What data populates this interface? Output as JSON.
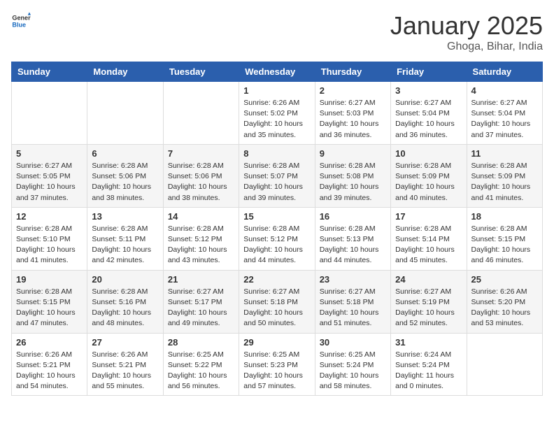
{
  "header": {
    "logo_general": "General",
    "logo_blue": "Blue",
    "title": "January 2025",
    "location": "Ghoga, Bihar, India"
  },
  "days_of_week": [
    "Sunday",
    "Monday",
    "Tuesday",
    "Wednesday",
    "Thursday",
    "Friday",
    "Saturday"
  ],
  "weeks": [
    [
      null,
      null,
      null,
      {
        "day": "1",
        "sunrise": "6:26 AM",
        "sunset": "5:02 PM",
        "daylight": "10 hours and 35 minutes."
      },
      {
        "day": "2",
        "sunrise": "6:27 AM",
        "sunset": "5:03 PM",
        "daylight": "10 hours and 36 minutes."
      },
      {
        "day": "3",
        "sunrise": "6:27 AM",
        "sunset": "5:04 PM",
        "daylight": "10 hours and 36 minutes."
      },
      {
        "day": "4",
        "sunrise": "6:27 AM",
        "sunset": "5:04 PM",
        "daylight": "10 hours and 37 minutes."
      }
    ],
    [
      {
        "day": "5",
        "sunrise": "6:27 AM",
        "sunset": "5:05 PM",
        "daylight": "10 hours and 37 minutes."
      },
      {
        "day": "6",
        "sunrise": "6:28 AM",
        "sunset": "5:06 PM",
        "daylight": "10 hours and 38 minutes."
      },
      {
        "day": "7",
        "sunrise": "6:28 AM",
        "sunset": "5:06 PM",
        "daylight": "10 hours and 38 minutes."
      },
      {
        "day": "8",
        "sunrise": "6:28 AM",
        "sunset": "5:07 PM",
        "daylight": "10 hours and 39 minutes."
      },
      {
        "day": "9",
        "sunrise": "6:28 AM",
        "sunset": "5:08 PM",
        "daylight": "10 hours and 39 minutes."
      },
      {
        "day": "10",
        "sunrise": "6:28 AM",
        "sunset": "5:09 PM",
        "daylight": "10 hours and 40 minutes."
      },
      {
        "day": "11",
        "sunrise": "6:28 AM",
        "sunset": "5:09 PM",
        "daylight": "10 hours and 41 minutes."
      }
    ],
    [
      {
        "day": "12",
        "sunrise": "6:28 AM",
        "sunset": "5:10 PM",
        "daylight": "10 hours and 41 minutes."
      },
      {
        "day": "13",
        "sunrise": "6:28 AM",
        "sunset": "5:11 PM",
        "daylight": "10 hours and 42 minutes."
      },
      {
        "day": "14",
        "sunrise": "6:28 AM",
        "sunset": "5:12 PM",
        "daylight": "10 hours and 43 minutes."
      },
      {
        "day": "15",
        "sunrise": "6:28 AM",
        "sunset": "5:12 PM",
        "daylight": "10 hours and 44 minutes."
      },
      {
        "day": "16",
        "sunrise": "6:28 AM",
        "sunset": "5:13 PM",
        "daylight": "10 hours and 44 minutes."
      },
      {
        "day": "17",
        "sunrise": "6:28 AM",
        "sunset": "5:14 PM",
        "daylight": "10 hours and 45 minutes."
      },
      {
        "day": "18",
        "sunrise": "6:28 AM",
        "sunset": "5:15 PM",
        "daylight": "10 hours and 46 minutes."
      }
    ],
    [
      {
        "day": "19",
        "sunrise": "6:28 AM",
        "sunset": "5:15 PM",
        "daylight": "10 hours and 47 minutes."
      },
      {
        "day": "20",
        "sunrise": "6:28 AM",
        "sunset": "5:16 PM",
        "daylight": "10 hours and 48 minutes."
      },
      {
        "day": "21",
        "sunrise": "6:27 AM",
        "sunset": "5:17 PM",
        "daylight": "10 hours and 49 minutes."
      },
      {
        "day": "22",
        "sunrise": "6:27 AM",
        "sunset": "5:18 PM",
        "daylight": "10 hours and 50 minutes."
      },
      {
        "day": "23",
        "sunrise": "6:27 AM",
        "sunset": "5:18 PM",
        "daylight": "10 hours and 51 minutes."
      },
      {
        "day": "24",
        "sunrise": "6:27 AM",
        "sunset": "5:19 PM",
        "daylight": "10 hours and 52 minutes."
      },
      {
        "day": "25",
        "sunrise": "6:26 AM",
        "sunset": "5:20 PM",
        "daylight": "10 hours and 53 minutes."
      }
    ],
    [
      {
        "day": "26",
        "sunrise": "6:26 AM",
        "sunset": "5:21 PM",
        "daylight": "10 hours and 54 minutes."
      },
      {
        "day": "27",
        "sunrise": "6:26 AM",
        "sunset": "5:21 PM",
        "daylight": "10 hours and 55 minutes."
      },
      {
        "day": "28",
        "sunrise": "6:25 AM",
        "sunset": "5:22 PM",
        "daylight": "10 hours and 56 minutes."
      },
      {
        "day": "29",
        "sunrise": "6:25 AM",
        "sunset": "5:23 PM",
        "daylight": "10 hours and 57 minutes."
      },
      {
        "day": "30",
        "sunrise": "6:25 AM",
        "sunset": "5:24 PM",
        "daylight": "10 hours and 58 minutes."
      },
      {
        "day": "31",
        "sunrise": "6:24 AM",
        "sunset": "5:24 PM",
        "daylight": "11 hours and 0 minutes."
      },
      null
    ]
  ]
}
